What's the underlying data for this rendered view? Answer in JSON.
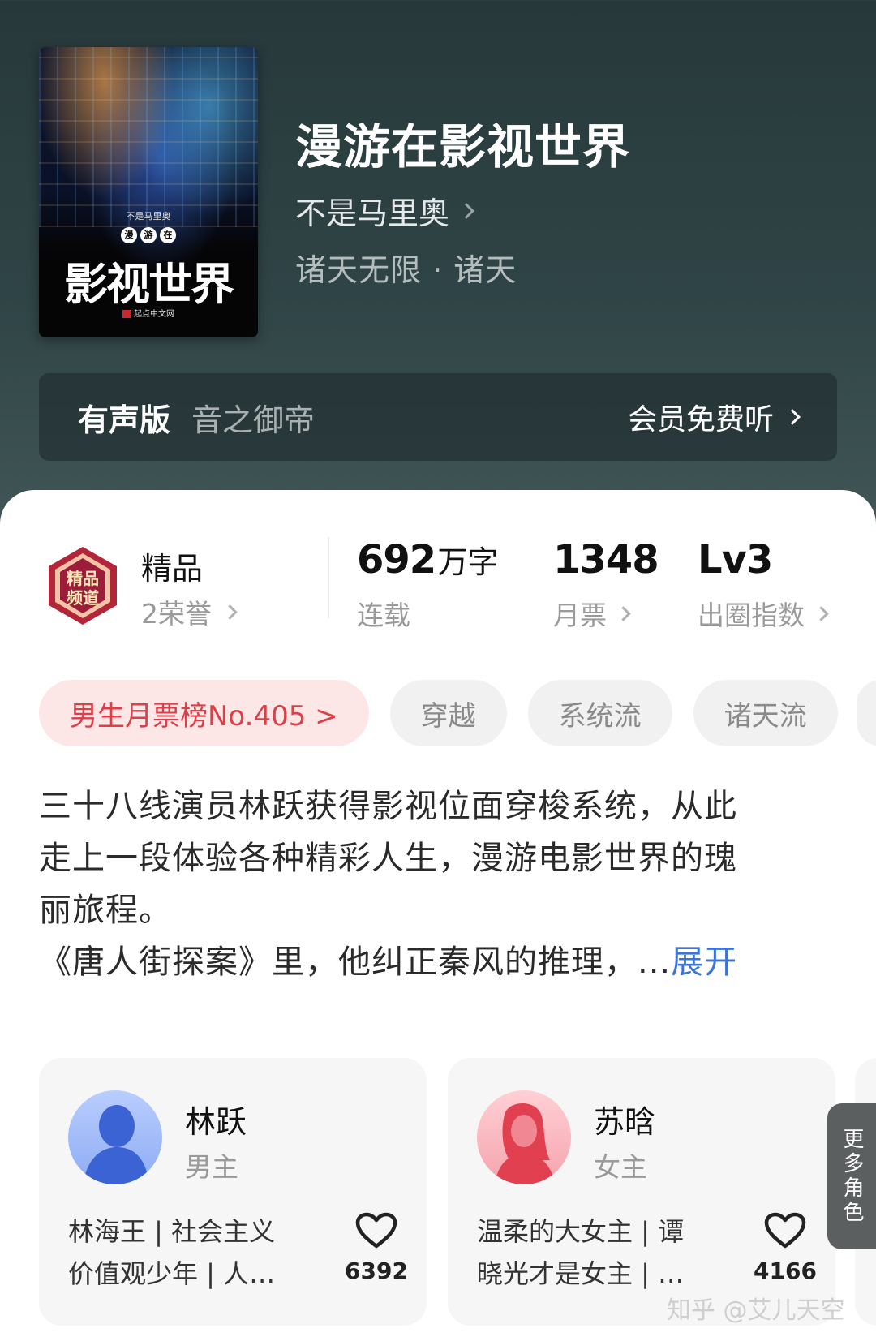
{
  "cover": {
    "author_small": "不是马里奥",
    "badges": [
      "漫",
      "游",
      "在"
    ],
    "title_big": "影视世界",
    "publisher": "起点中文网"
  },
  "book": {
    "title": "漫游在影视世界",
    "author": "不是马里奥",
    "genre": "诸天无限 · 诸天"
  },
  "audio": {
    "label": "有声版",
    "narrator": "音之御帝",
    "cta": "会员免费听"
  },
  "honor": {
    "badge_text": "精品频道",
    "name": "精品",
    "count": "2荣誉"
  },
  "stats": [
    {
      "value": "692",
      "unit": "万字",
      "label": "连载"
    },
    {
      "value": "1348",
      "unit": "",
      "label": "月票"
    },
    {
      "value": "Lv3",
      "unit": "",
      "label": "出圈指数"
    }
  ],
  "tags": {
    "rank": "男生月票榜No.405 >",
    "items": [
      "穿越",
      "系统流",
      "诸天流"
    ]
  },
  "description": {
    "line1": "三十八线演员林跃获得影视位面穿梭系统，从此",
    "line2": "走上一段体验各种精彩人生，漫游电影世界的瑰",
    "line3": "丽旅程。",
    "line4": "《唐人街探案》里，他纠正秦风的推理，...",
    "expand": "展开"
  },
  "characters": [
    {
      "name": "林跃",
      "role": "男主",
      "desc1": "林海王 | 社会主义",
      "desc2": "价值观少年 | 人…",
      "likes": "6392",
      "avatar_color": "#5b86e5"
    },
    {
      "name": "苏晗",
      "role": "女主",
      "desc1": "温柔的大女主 | 谭",
      "desc2": "晓光才是女主 | …",
      "likes": "4166",
      "avatar_color": "#ec5b6a"
    }
  ],
  "more_roles": "更多角色",
  "watermark": "知乎 @艾儿天空"
}
